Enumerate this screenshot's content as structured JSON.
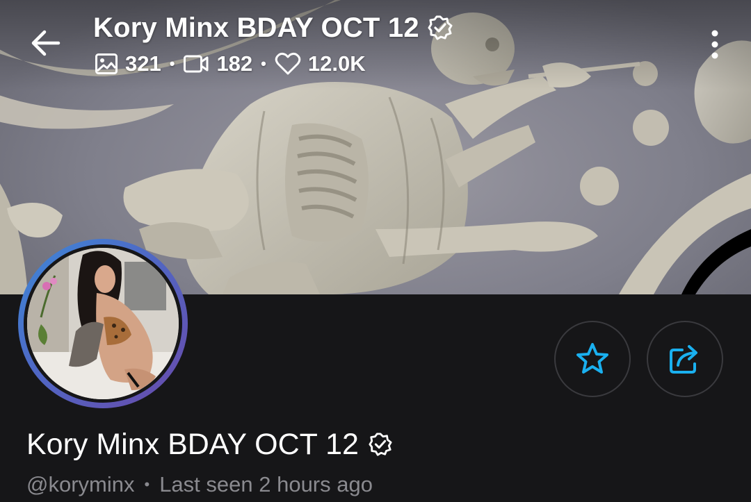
{
  "header": {
    "title": "Kory Minx BDAY OCT 12",
    "stats": {
      "photos": "321",
      "videos": "182",
      "likes": "12.0K"
    },
    "separator": "•"
  },
  "profile": {
    "name": "Kory Minx BDAY OCT 12",
    "username": "@koryminx",
    "separator": "•",
    "last_seen": "Last seen 2 hours ago"
  },
  "icons": {
    "back": "arrow-left-icon",
    "verified": "verified-badge-icon",
    "photo": "image-icon",
    "video": "video-camera-icon",
    "like": "heart-icon",
    "more": "vertical-dots-icon",
    "favorite": "star-icon",
    "share": "share-icon"
  },
  "colors": {
    "background": "#161618",
    "accent": "#1ab0ef",
    "muted_text": "#8a8a8f",
    "button_border": "#3a3a3e",
    "avatar_ring_start": "#3d89d8",
    "avatar_ring_end": "#6a4aaa"
  }
}
